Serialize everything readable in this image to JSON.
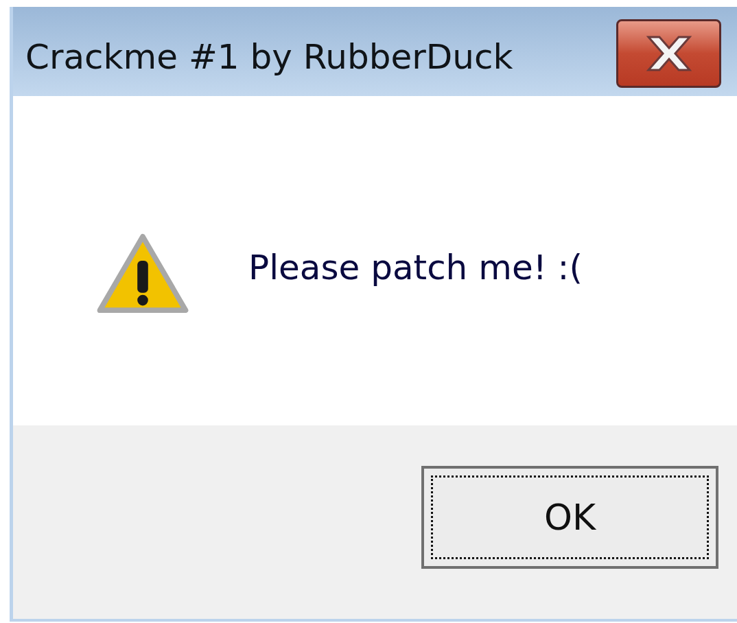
{
  "window": {
    "title": "Crackme #1 by RubberDuck"
  },
  "message": {
    "text": "Please patch me! :("
  },
  "buttons": [
    {
      "label": "OK",
      "focused": true
    }
  ]
}
